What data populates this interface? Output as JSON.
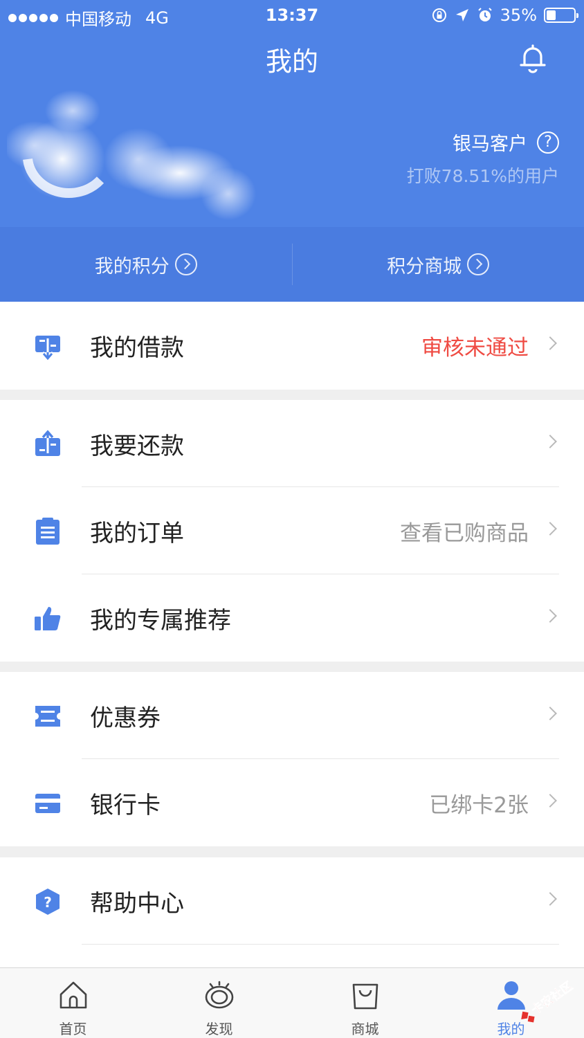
{
  "status_bar": {
    "carrier": "中国移动",
    "network": "4G",
    "time": "13:37",
    "battery": "35%",
    "battery_level": 0.35
  },
  "header": {
    "title": "我的",
    "level": "银马客户",
    "help_symbol": "?",
    "beat_text": "打败78.51%的用户",
    "points": [
      {
        "label": "我的积分",
        "icon": "circle-arrow-right-icon"
      },
      {
        "label": "积分商城",
        "icon": "circle-arrow-right-icon"
      }
    ]
  },
  "menu": {
    "loan": {
      "label": "我的借款",
      "value": "审核未通过",
      "icon": "loan-icon",
      "value_color": "#ef4b43"
    },
    "repay": {
      "label": "我要还款",
      "icon": "repay-icon"
    },
    "orders": {
      "label": "我的订单",
      "value": "查看已购商品",
      "icon": "clipboard-icon"
    },
    "recommend": {
      "label": "我的专属推荐",
      "icon": "thumbs-up-icon"
    },
    "coupons": {
      "label": "优惠券",
      "icon": "ticket-icon"
    },
    "bank": {
      "label": "银行卡",
      "value": "已绑卡2张",
      "icon": "card-icon"
    },
    "help": {
      "label": "帮助中心",
      "icon": "help-hexagon-icon",
      "symbol": "?"
    }
  },
  "tabbar": [
    {
      "label": "首页",
      "icon": "home-icon"
    },
    {
      "label": "发现",
      "icon": "discover-icon"
    },
    {
      "label": "商城",
      "icon": "shopping-bag-icon"
    },
    {
      "label": "我的",
      "icon": "user-icon",
      "active": true
    }
  ],
  "watermark": {
    "text": "卡农社区"
  },
  "colors": {
    "brand": "#4f83e6",
    "alert": "#ef4b43"
  }
}
